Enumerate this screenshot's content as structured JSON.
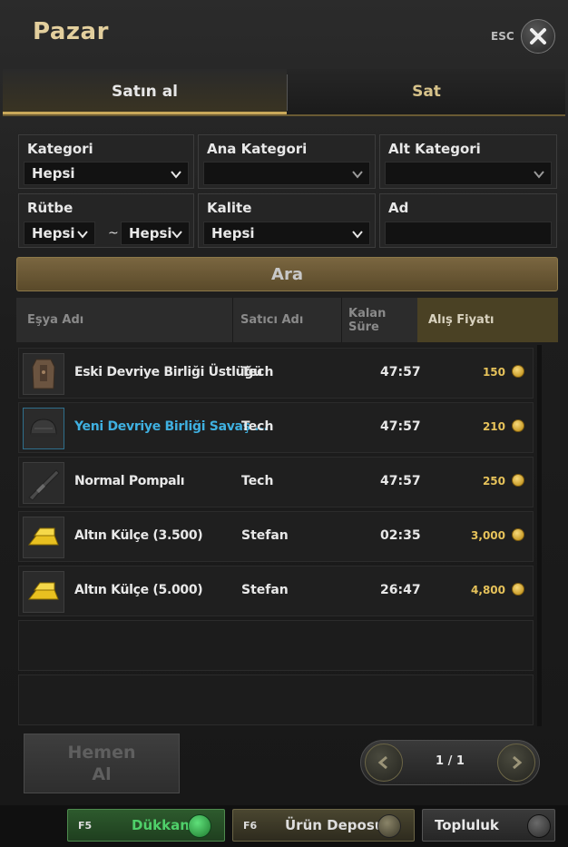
{
  "window": {
    "title": "Pazar",
    "esc_label": "ESC"
  },
  "tabs": [
    {
      "label": "Satın al",
      "active": true
    },
    {
      "label": "Sat",
      "active": false
    }
  ],
  "filters": {
    "kategori": {
      "label": "Kategori",
      "value": "Hepsi"
    },
    "ana_kategori": {
      "label": "Ana Kategori",
      "value": ""
    },
    "alt_kategori": {
      "label": "Alt Kategori",
      "value": ""
    },
    "rutbe": {
      "label": "Rütbe",
      "from": "Hepsi",
      "separator": "~",
      "to": "Hepsi"
    },
    "kalite": {
      "label": "Kalite",
      "value": "Hepsi"
    },
    "ad": {
      "label": "Ad",
      "value": ""
    }
  },
  "search_button": "Ara",
  "table": {
    "headers": [
      "Eşya Adı",
      "Satıcı Adı",
      "Kalan Süre",
      "Alış Fiyatı"
    ],
    "rows": [
      {
        "name": "Eski Devriye Birliği Üstlüğü",
        "seller": "Tech",
        "time": "47:57",
        "price": "150",
        "icon": "vest-icon",
        "highlight": false
      },
      {
        "name": "Yeni Devriye Birliği Savaş ...",
        "seller": "Tech",
        "time": "47:57",
        "price": "210",
        "icon": "helmet-icon",
        "highlight": true
      },
      {
        "name": "Normal Pompalı",
        "seller": "Tech",
        "time": "47:57",
        "price": "250",
        "icon": "shotgun-icon",
        "highlight": false
      },
      {
        "name": "Altın Külçe (3.500)",
        "seller": "Stefan",
        "time": "02:35",
        "price": "3,000",
        "icon": "gold-bar-icon",
        "highlight": false
      },
      {
        "name": "Altın Külçe (5.000)",
        "seller": "Stefan",
        "time": "26:47",
        "price": "4,800",
        "icon": "gold-bar-icon",
        "highlight": false
      }
    ]
  },
  "buy_now": {
    "line1": "Hemen",
    "line2": "Al"
  },
  "pagination": {
    "text": "1 / 1"
  },
  "bottom_bar": {
    "shop": {
      "key": "F5",
      "label": "Dükkan"
    },
    "storage": {
      "key": "F6",
      "label": "Ürün Deposu"
    },
    "community": {
      "label": "Topluluk"
    }
  },
  "colors": {
    "accent_gold": "#c9a85a",
    "highlight_blue": "#3fb0e0",
    "shop_green": "#3fc25a"
  }
}
